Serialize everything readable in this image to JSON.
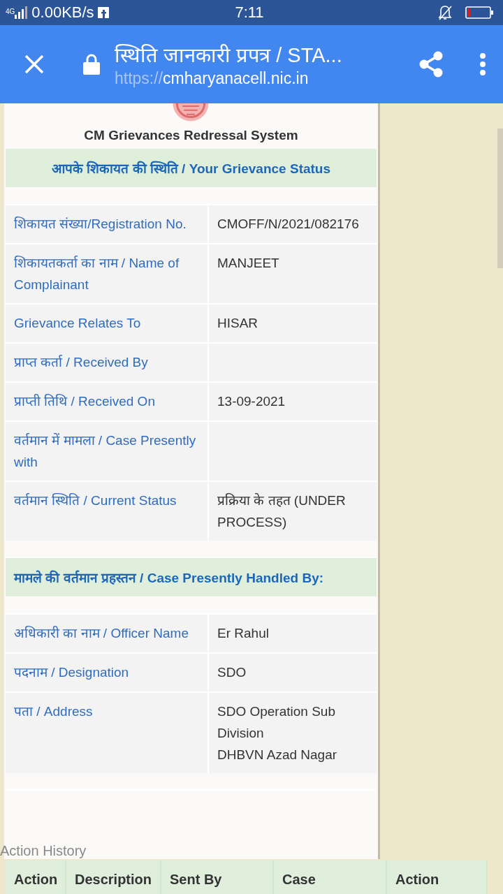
{
  "status_bar": {
    "network": "4G",
    "speed": "0.00KB/s",
    "time": "7:11"
  },
  "browser_toolbar": {
    "title": "स्थिति जानकारी प्रपत्र / STA...",
    "url_scheme": "https://",
    "url_host": "cmharyanacell.nic.in"
  },
  "page": {
    "system_title": "CM Grievances Redressal System",
    "sections": [
      {
        "heading": "आपके शिकायत की स्थिति / Your Grievance Status",
        "kind": "banner",
        "rows": [
          {
            "label": "शिकायत संख्या/Registration No.",
            "value": "CMOFF/N/2021/082176"
          },
          {
            "label": "शिकायतकर्ता का नाम / Name of Complainant",
            "value": "MANJEET"
          },
          {
            "label": "Grievance Relates To",
            "value": "HISAR"
          },
          {
            "label": "प्राप्त कर्ता / Received By"
          },
          {
            "label": "प्राप्ती तिथि / Received On",
            "value": "13-09-2021"
          },
          {
            "label": "वर्तमान में मामला / Case Presently with"
          },
          {
            "label": "वर्तमान स्थिति / Current Status",
            "value": "प्रक्रिया के तहत (UNDER PROCESS)"
          }
        ]
      },
      {
        "heading": "मामले की वर्तमान प्रहस्तन / Case Presently Handled By:",
        "kind": "subhead",
        "rows": [
          {
            "label": "अधिकारी का नाम / Officer Name",
            "value": "Er Rahul"
          },
          {
            "label": "पदनाम / Designation",
            "value": "SDO"
          },
          {
            "label": "पता / Address",
            "value": "SDO Operation Sub Division\nDHBVN Azad Nagar"
          }
        ]
      }
    ]
  },
  "action_history": {
    "title": "Action History",
    "columns": [
      "Action",
      "Description",
      "Sent By",
      "Case",
      "Action"
    ]
  }
}
